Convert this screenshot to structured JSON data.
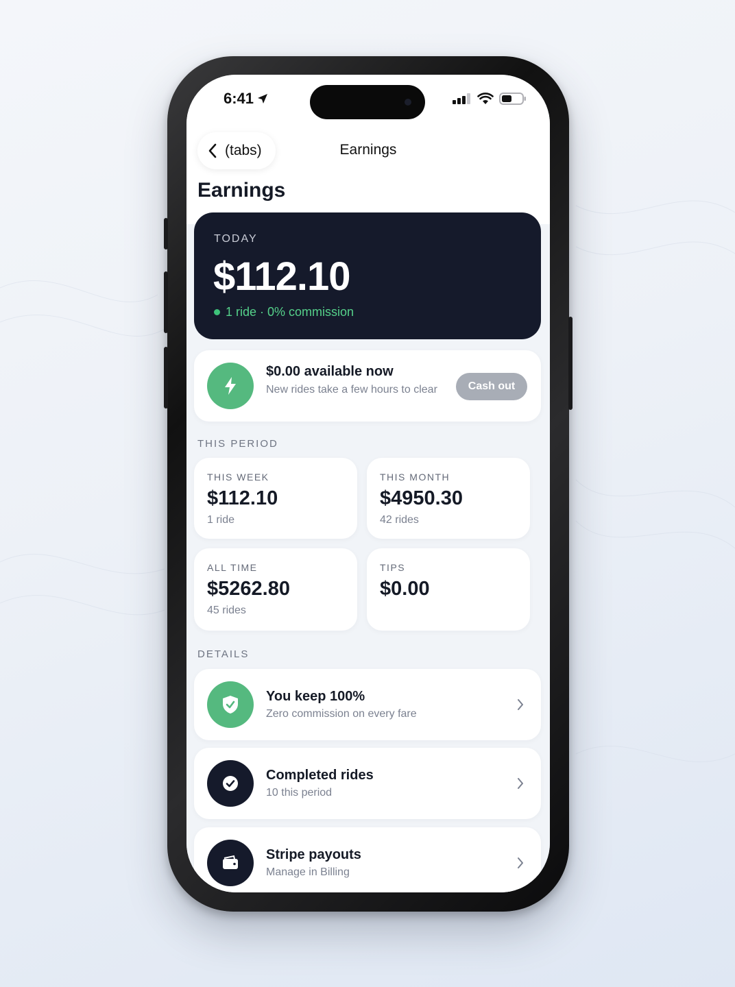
{
  "status_bar": {
    "time": "6:41"
  },
  "nav": {
    "back_label": "(tabs)",
    "title": "Earnings"
  },
  "page_title": "Earnings",
  "today": {
    "label": "TODAY",
    "amount": "$112.10",
    "summary": "1 ride · 0% commission"
  },
  "available": {
    "title": "$0.00 available now",
    "description": "New rides take a few hours to clear",
    "button_label": "Cash out",
    "icon": "lightning-icon"
  },
  "period": {
    "section_label": "THIS PERIOD",
    "stats": [
      {
        "label": "THIS WEEK",
        "value": "$112.10",
        "sub": "1 ride"
      },
      {
        "label": "THIS MONTH",
        "value": "$4950.30",
        "sub": "42 rides"
      },
      {
        "label": "ALL TIME",
        "value": "$5262.80",
        "sub": "45 rides"
      },
      {
        "label": "TIPS",
        "value": "$0.00",
        "sub": ""
      }
    ]
  },
  "details": {
    "section_label": "DETAILS",
    "items": [
      {
        "title": "You keep 100%",
        "description": "Zero commission on every fare",
        "icon": "shield-check-icon"
      },
      {
        "title": "Completed rides",
        "description": "10 this period",
        "icon": "check-circle-icon"
      },
      {
        "title": "Stripe payouts",
        "description": "Manage in Billing",
        "icon": "wallet-icon"
      }
    ]
  },
  "colors": {
    "navy": "#151a2b",
    "green": "#55b97f",
    "accent_green_text": "#55d18a",
    "disabled_button": "#a8adb6"
  }
}
